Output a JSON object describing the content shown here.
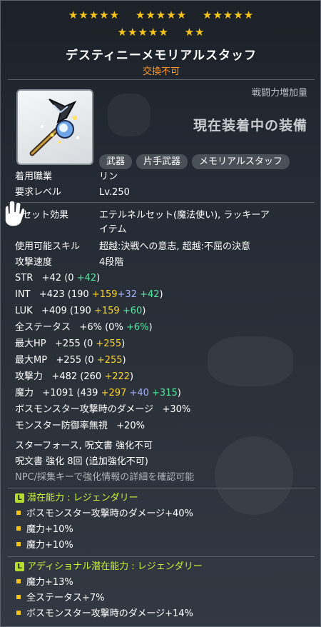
{
  "stars": {
    "row1": [
      "★★★★★",
      "★★★★★",
      "★★★★★"
    ],
    "row2": [
      "★★★★★",
      "★★"
    ]
  },
  "item": {
    "name": "デスティニーメモリアルスタッフ",
    "tradeable": "交換不可"
  },
  "header": {
    "power_label": "戦闘力増加量",
    "equip_state": "現在装着中の装備"
  },
  "tags": [
    "武器",
    "片手武器",
    "メモリアルスタッフ"
  ],
  "info": [
    {
      "label": "着用職業",
      "value": "リン"
    },
    {
      "label": "要求レベル",
      "value": "Lv.250"
    }
  ],
  "set_effect": {
    "label": "セット効果",
    "value_line1": "エテルネルセット(魔法使い), ラッキーア",
    "value_line2": "イテム"
  },
  "skill": {
    "label": "使用可能スキル",
    "value": "超越:決戦への意志, 超越:不屈の決意"
  },
  "attack_speed": {
    "label": "攻撃速度",
    "value": "4段階"
  },
  "stats": [
    {
      "name": "STR",
      "total": "+42",
      "base": "0",
      "star": "",
      "flame": "",
      "add": "+42"
    },
    {
      "name": "INT",
      "total": "+423",
      "base": "190",
      "star": "+159",
      "flame": "+32",
      "add": "+42"
    },
    {
      "name": "LUK",
      "total": "+409",
      "base": "190",
      "star": "+159",
      "flame": "",
      "add": "+60"
    },
    {
      "name": "全ステータス",
      "total": "+6%",
      "base": "0%",
      "star": "",
      "flame": "",
      "add": "+6%"
    },
    {
      "name": "最大HP",
      "total": "+255",
      "base": "0",
      "star": "+255",
      "flame": "",
      "add": ""
    },
    {
      "name": "最大MP",
      "total": "+255",
      "base": "0",
      "star": "+255",
      "flame": "",
      "add": ""
    },
    {
      "name": "攻撃力",
      "total": "+482",
      "base": "260",
      "star": "+222",
      "flame": "",
      "add": ""
    },
    {
      "name": "魔力",
      "total": "+1091",
      "base": "439",
      "star": "+297",
      "flame": "+40",
      "add": "+315"
    }
  ],
  "extra_stats": [
    {
      "label": "ボスモンスター攻撃時のダメージ",
      "value": "+30%"
    },
    {
      "label": "モンスター防御率無視",
      "value": "+20%"
    }
  ],
  "enhance": {
    "line1": "スターフォース, 呪文書 強化不可",
    "line2": "呪文書 強化 8回 (追加強化不可)",
    "line3": "NPC/採集キーで強化情報の詳細を確認可能"
  },
  "potential": {
    "badge": "L",
    "title": "潜在能力 : レジェンダリー",
    "lines": [
      "ボスモンスター攻撃時のダメージ+40%",
      "魔力+10%",
      "魔力+10%"
    ]
  },
  "additional": {
    "badge": "L",
    "title": "アディショナル潜在能力 : レジェンダリー",
    "lines": [
      "魔力+13%",
      "全ステータス+7%",
      "ボスモンスター攻撃時のダメージ+14%"
    ]
  },
  "colors": {
    "star": "#f7c51a",
    "untradeable": "#ff9a2e",
    "starforce": "#ffd428",
    "flame": "#a8b4ff",
    "additional": "#57e6a0",
    "legendary": "#c6f23a"
  }
}
